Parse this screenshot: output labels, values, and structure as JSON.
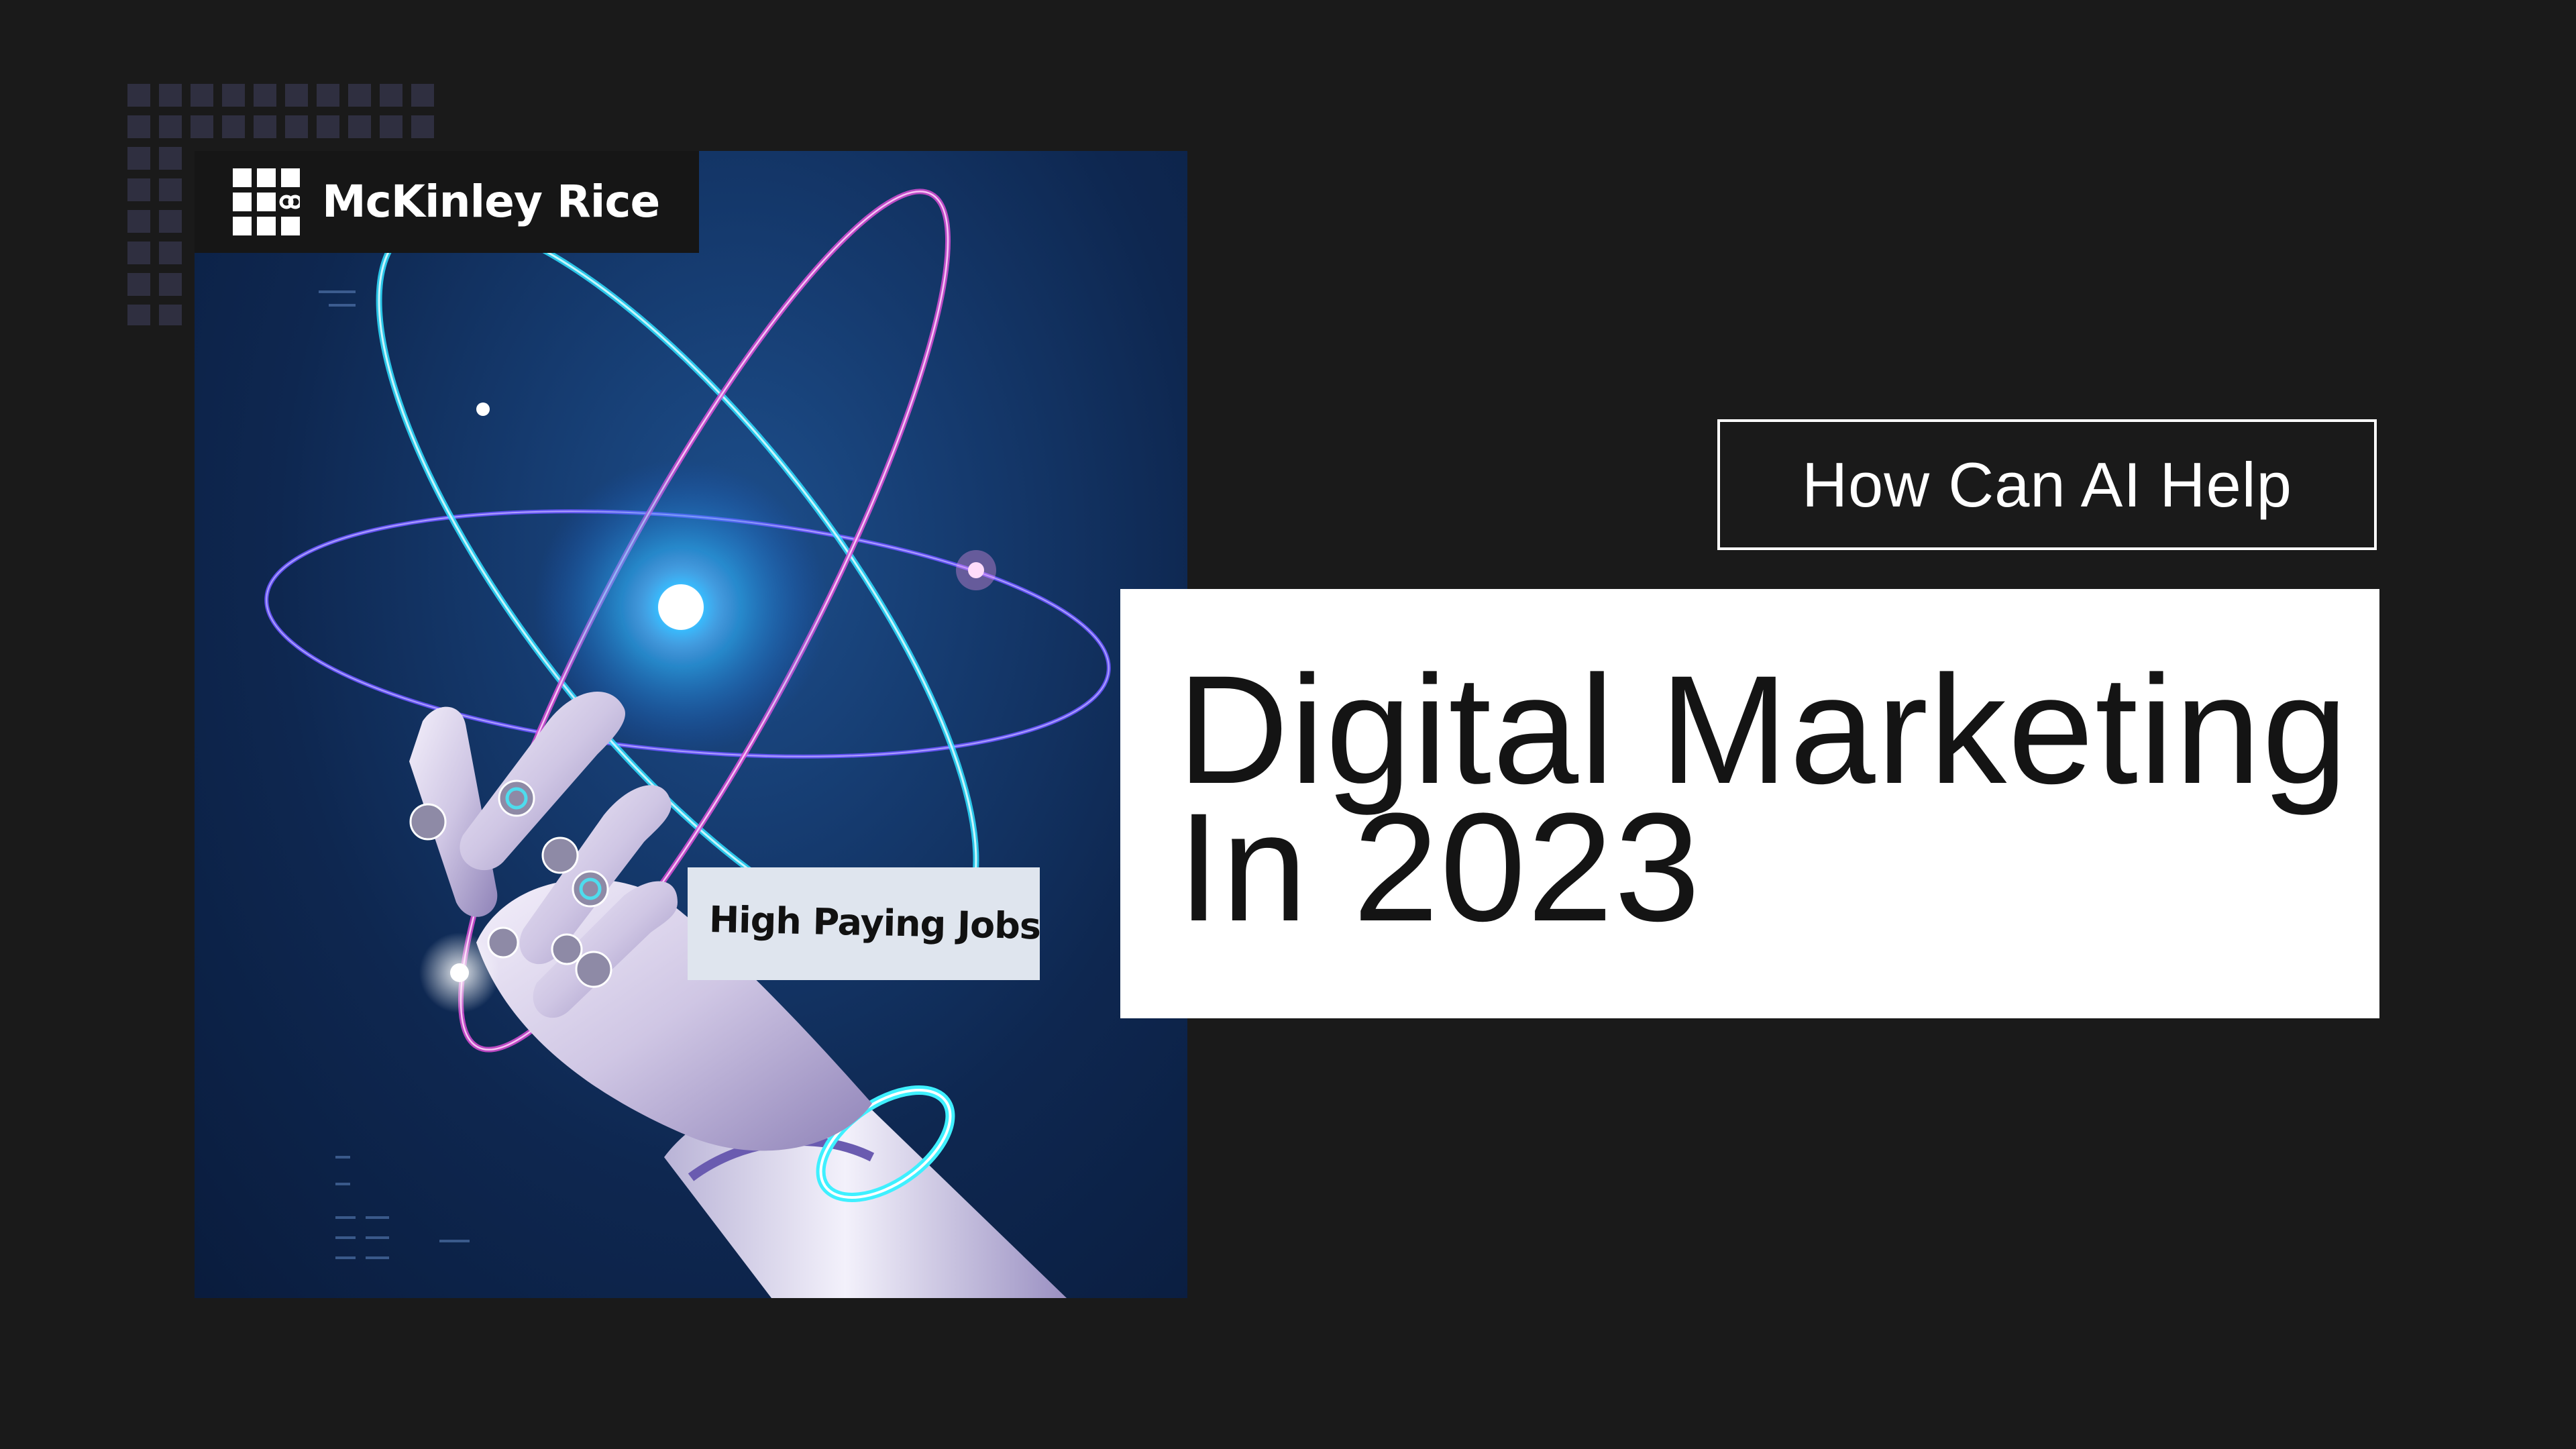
{
  "brand": {
    "name": "McKinley Rice",
    "logo_icon": "mckinley-rice-grid-logo-icon"
  },
  "hero": {
    "image": "robotic-hand-atom-illustration",
    "tag_label": "High Paying Jobs"
  },
  "headline": {
    "eyebrow": "How Can AI Help",
    "title_line_1": "Digital Marketing",
    "title_line_2": "In 2023"
  },
  "colors": {
    "background": "#1a1a1a",
    "panel_blue": "#0e2750",
    "accent_cyan": "#5fe8ff",
    "accent_magenta": "#e05bd8",
    "title_box": "#ffffff",
    "tag_box": "#dfe5ee"
  }
}
